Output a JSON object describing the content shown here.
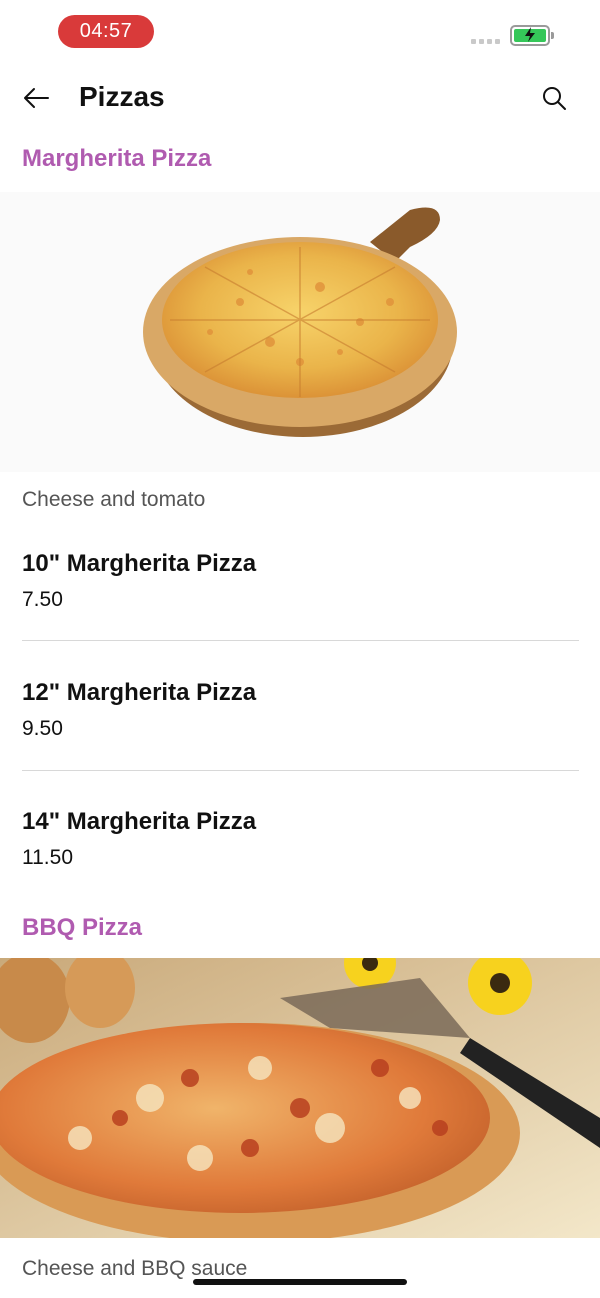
{
  "status_bar": {
    "time": "04:57",
    "time_pill_color": "#d93a3a",
    "battery_color": "#35c759",
    "signal_icon": "signal-dots-icon",
    "battery_icon": "battery-charging-icon"
  },
  "header": {
    "title": "Pizzas",
    "back_icon": "arrow-left-icon",
    "search_icon": "search-icon"
  },
  "accent_color": "#b05bb0",
  "sections": [
    {
      "title": "Margherita Pizza",
      "description": "Cheese and tomato",
      "items": [
        {
          "name": "10\" Margherita Pizza",
          "price": "7.50"
        },
        {
          "name": "12\" Margherita Pizza",
          "price": "9.50"
        },
        {
          "name": "14\" Margherita Pizza",
          "price": "11.50"
        }
      ]
    },
    {
      "title": "BBQ Pizza",
      "description": "Cheese and BBQ sauce"
    }
  ]
}
